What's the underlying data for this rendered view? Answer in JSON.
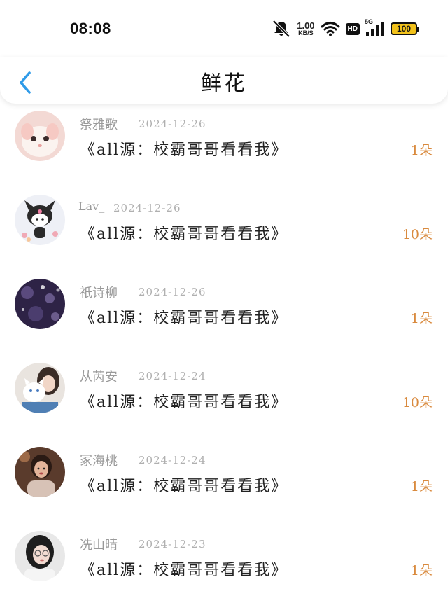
{
  "status_bar": {
    "time": "08:08",
    "net_speed_value": "1.00",
    "net_speed_unit": "KB/S",
    "hd_label": "HD",
    "signal_label": "5G",
    "battery": "100",
    "icons": [
      "mute-icon",
      "wifi-icon",
      "signal-icon",
      "battery-icon"
    ]
  },
  "header": {
    "back_icon": "chevron-left-icon",
    "title": "鲜花"
  },
  "colors": {
    "accent_blue": "#2f9be8",
    "count_orange": "#d98a3e",
    "battery_yellow": "#f2c21b"
  },
  "items": [
    {
      "username": "祭雅歌",
      "date": "2024-12-26",
      "message": "《all源：校霸哥哥看看我》",
      "count": "1朵",
      "avatar": "rabbit-avatar"
    },
    {
      "username": "Lav_",
      "date": "2024-12-26",
      "message": "《all源：校霸哥哥看看我》",
      "count": "10朵",
      "avatar": "kuromi-avatar"
    },
    {
      "username": "祇诗柳",
      "date": "2024-12-26",
      "message": "《all源：校霸哥哥看看我》",
      "count": "1朵",
      "avatar": "bokeh-avatar"
    },
    {
      "username": "从芮安",
      "date": "2024-12-24",
      "message": "《all源：校霸哥哥看看我》",
      "count": "10朵",
      "avatar": "girl-with-cat-avatar"
    },
    {
      "username": "冢海桃",
      "date": "2024-12-24",
      "message": "《all源：校霸哥哥看看我》",
      "count": "1朵",
      "avatar": "portrait-avatar"
    },
    {
      "username": "冼山晴",
      "date": "2024-12-23",
      "message": "《all源：校霸哥哥看看我》",
      "count": "1朵",
      "avatar": "glasses-girl-avatar"
    }
  ]
}
